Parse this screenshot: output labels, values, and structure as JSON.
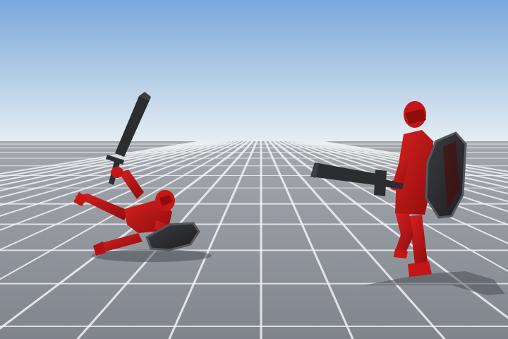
{
  "scene": {
    "sky_top_color": "#7aa8dc",
    "sky_horizon_color": "#e6eef2",
    "ground_color": "#8a8f97",
    "grid_line_color": "#f2f4f6",
    "character_color": "#c41616",
    "character_shade_color": "#8e0d0d",
    "weapon_color": "#2c2d30",
    "shadow_color": "#4a4e55"
  },
  "characters": [
    {
      "id": "fallen-knight",
      "state": "knocked-down",
      "weapon": "sword-icon",
      "shield": "shield-icon"
    },
    {
      "id": "standing-knight",
      "state": "guarding",
      "weapon": "sword-icon",
      "shield": "shield-icon"
    }
  ]
}
